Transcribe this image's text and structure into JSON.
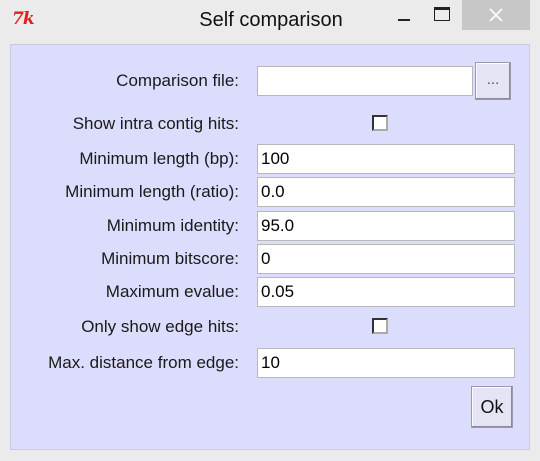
{
  "window": {
    "title": "Self comparison",
    "app_icon_text": "7k"
  },
  "icons": {
    "minimize": "minimize-icon",
    "maximize": "maximize-icon",
    "close": "close-icon"
  },
  "form": {
    "comparison_file": {
      "label": "Comparison file:",
      "value": "",
      "browse_label": "..."
    },
    "show_intra_contig_hits": {
      "label": "Show intra contig hits:",
      "checked": false
    },
    "min_length_bp": {
      "label": "Minimum length (bp):",
      "value": "100"
    },
    "min_length_ratio": {
      "label": "Minimum length (ratio):",
      "value": "0.0"
    },
    "min_identity": {
      "label": "Minimum identity:",
      "value": "95.0"
    },
    "min_bitscore": {
      "label": "Minimum bitscore:",
      "value": "0"
    },
    "max_evalue": {
      "label": "Maximum evalue:",
      "value": "0.05"
    },
    "only_edge_hits": {
      "label": "Only show edge hits:",
      "checked": false
    },
    "max_distance_edge": {
      "label": "Max. distance from edge:",
      "value": "10"
    }
  },
  "buttons": {
    "ok_label": "Ok"
  },
  "colors": {
    "panel_background": "#dcdcfc",
    "icon_red": "#e0201c"
  }
}
